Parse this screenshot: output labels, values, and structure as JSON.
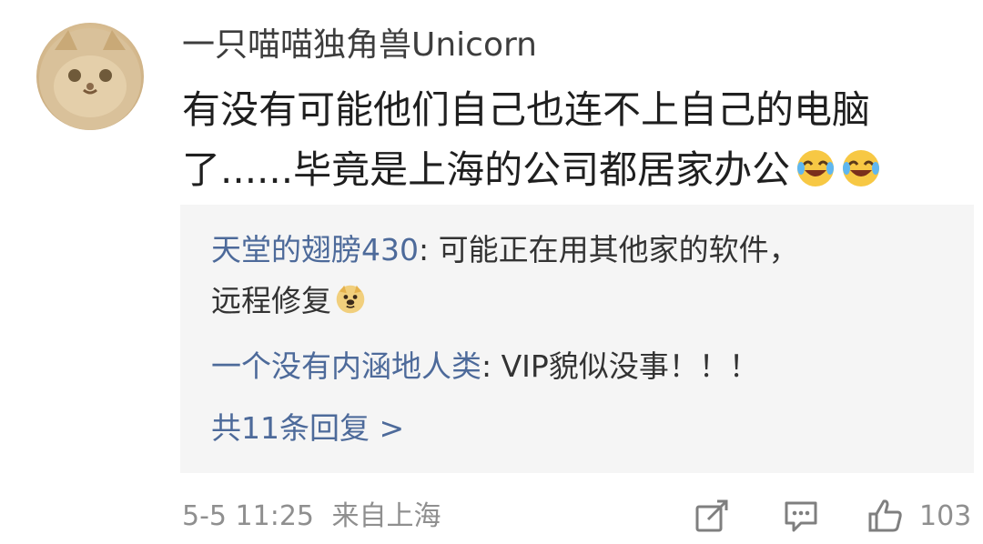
{
  "post": {
    "author": "一只喵喵独角兽Unicorn",
    "comment_line1": "有没有可能他们自己也连不上自己的电脑",
    "comment_line2": "了......毕竟是上海的公司都居家办公"
  },
  "replies": [
    {
      "name": "天堂的翅膀430",
      "separator": ": ",
      "text_line1": "可能正在用其他家的软件，",
      "text_line2": "远程修复"
    },
    {
      "name": "一个没有内涵地人类",
      "separator": ": ",
      "text": "VIP貌似没事！！！"
    }
  ],
  "more_replies": "共11条回复 >",
  "footer": {
    "timestamp": "5-5 11:25",
    "source": "来自上海",
    "like_count": "103"
  },
  "icons": [
    "share-icon",
    "comment-icon",
    "like-icon",
    "laughing-tears-emoji",
    "doge-emoji"
  ]
}
